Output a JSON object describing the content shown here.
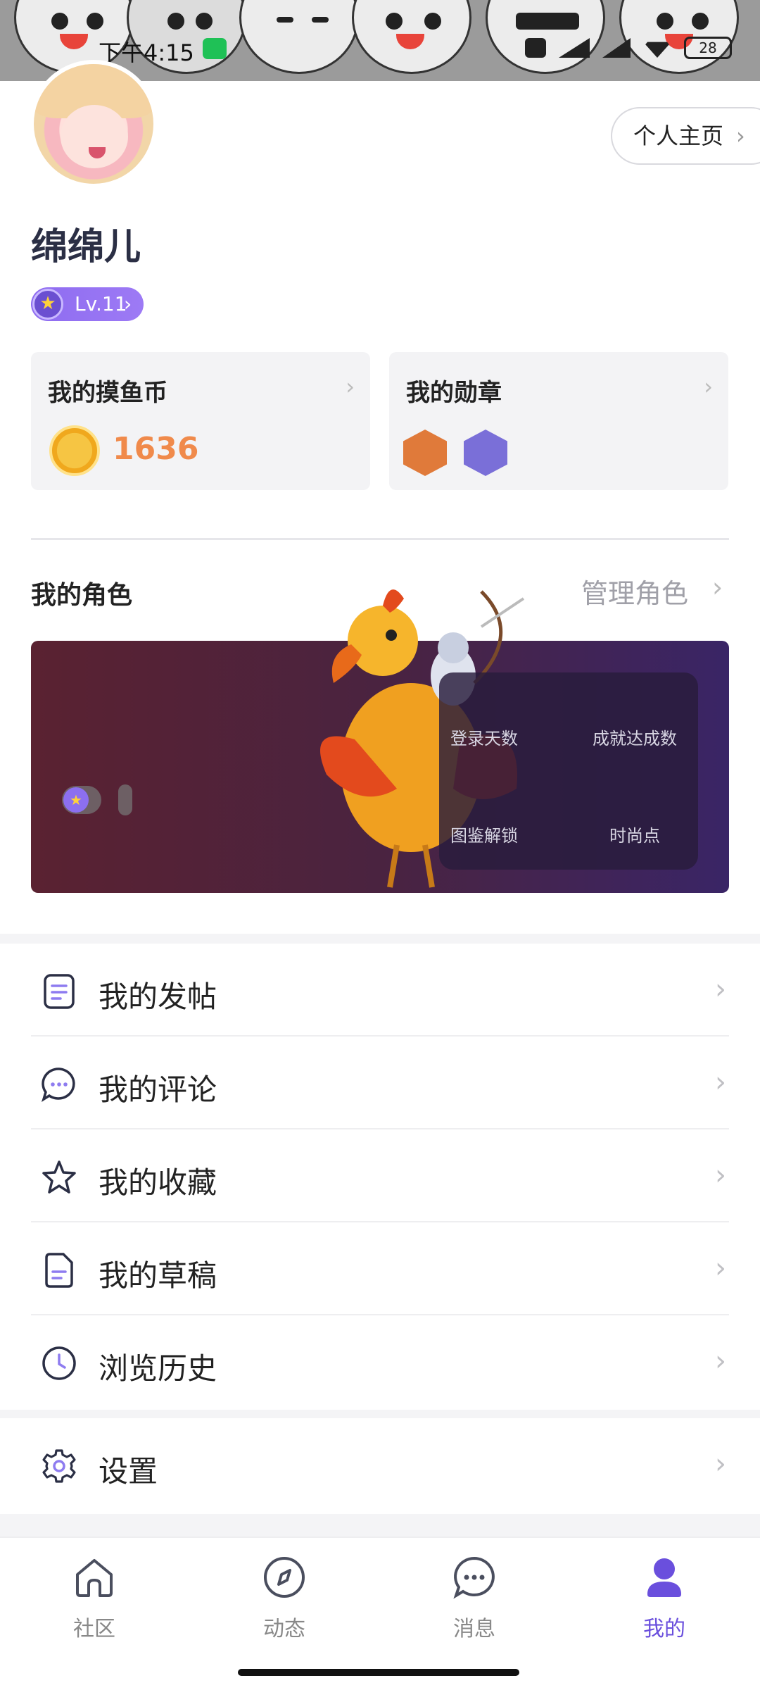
{
  "status_bar": {
    "time": "下午4:15",
    "battery": "28"
  },
  "profile": {
    "homepage_button": "个人主页",
    "username": "绵绵儿",
    "level": "Lv.11"
  },
  "cards": {
    "coins": {
      "title": "我的摸鱼币",
      "value": "1636"
    },
    "medals": {
      "title": "我的勋章"
    }
  },
  "roles": {
    "section_title": "我的角色",
    "manage_link": "管理角色",
    "stats": {
      "login_days": "登录天数",
      "achievements": "成就达成数",
      "codex_unlock": "图鉴解锁",
      "fashion_points": "时尚点"
    }
  },
  "menu": [
    {
      "label": "我的发帖",
      "icon": "document-icon"
    },
    {
      "label": "我的评论",
      "icon": "comment-icon"
    },
    {
      "label": "我的收藏",
      "icon": "star-icon"
    },
    {
      "label": "我的草稿",
      "icon": "draft-icon"
    },
    {
      "label": "浏览历史",
      "icon": "clock-icon"
    }
  ],
  "settings": {
    "label": "设置",
    "icon": "gear-icon"
  },
  "tabs": [
    {
      "label": "社区",
      "icon": "home-icon"
    },
    {
      "label": "动态",
      "icon": "compass-icon"
    },
    {
      "label": "消息",
      "icon": "message-icon"
    },
    {
      "label": "我的",
      "icon": "profile-icon",
      "active": true
    }
  ],
  "colors": {
    "accent": "#6a4fdd",
    "coin": "#f08a4b",
    "text": "#2b2f45"
  }
}
